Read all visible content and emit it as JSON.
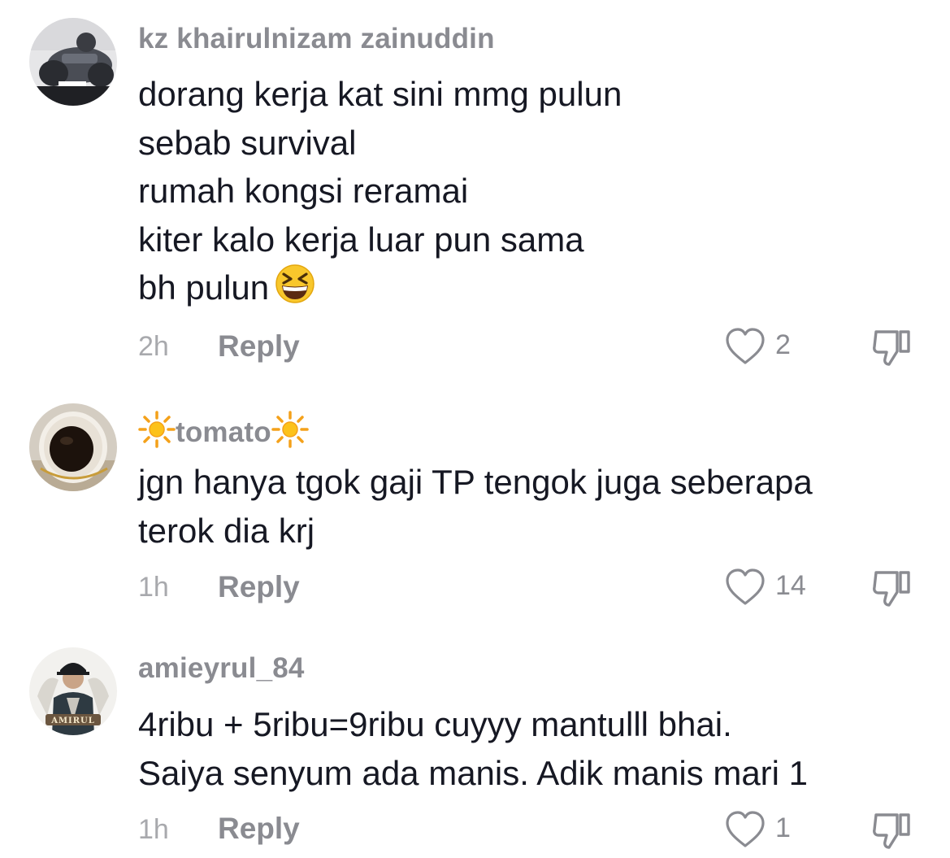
{
  "comments": [
    {
      "username": "kz khairulnizam zainuddin",
      "lines": [
        "dorang kerja kat sini mmg pulun",
        "sebab survival",
        "rumah kongsi reramai",
        "kiter kalo kerja luar pun sama",
        "bh pulun"
      ],
      "emoji": "grinning-squinting-face",
      "time": "2h",
      "reply_label": "Reply",
      "likes": "2"
    },
    {
      "username": "tomato",
      "username_decoration": "sun-icon",
      "lines": [
        "jgn hanya tgok gaji TP tengok juga seberapa",
        "terok dia krj"
      ],
      "time": "1h",
      "reply_label": "Reply",
      "likes": "14"
    },
    {
      "username": "amieyrul_84",
      "lines": [
        "4ribu + 5ribu=9ribu cuyyy mantulll bhai.",
        "Saiya senyum ada manis. Adik manis mari 1"
      ],
      "time": "1h",
      "reply_label": "Reply",
      "likes": "1",
      "avatar_text": "AMIRUL"
    }
  ],
  "colors": {
    "text": "#161823",
    "username": "#8a8b91",
    "meta": "#a8a9ad",
    "icon_stroke": "#8a8b91"
  }
}
